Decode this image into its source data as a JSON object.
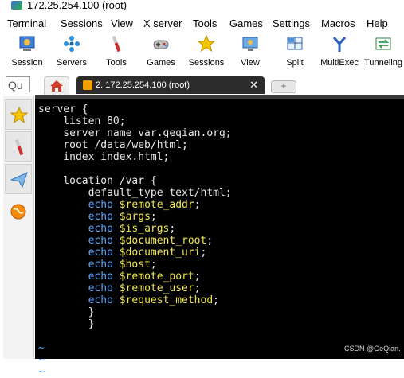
{
  "window": {
    "title": "172.25.254.100 (root)"
  },
  "menu": [
    "Terminal",
    "Sessions",
    "View",
    "X server",
    "Tools",
    "Games",
    "Settings",
    "Macros",
    "Help"
  ],
  "toolbar": [
    {
      "label": "Session",
      "icon": "session-icon"
    },
    {
      "label": "Servers",
      "icon": "servers-icon"
    },
    {
      "label": "Tools",
      "icon": "tools-icon"
    },
    {
      "label": "Games",
      "icon": "games-icon"
    },
    {
      "label": "Sessions",
      "icon": "star-icon"
    },
    {
      "label": "View",
      "icon": "view-icon"
    },
    {
      "label": "Split",
      "icon": "split-icon"
    },
    {
      "label": "MultiExec",
      "icon": "multiexec-icon"
    },
    {
      "label": "Tunneling",
      "icon": "tunneling-icon"
    }
  ],
  "quick_connect": {
    "value": "Qu"
  },
  "tab": {
    "label": "2. 172.25.254.100 (root)",
    "close": "✕"
  },
  "new_tab": "+",
  "terminal": {
    "lines": [
      {
        "text": "server {",
        "type": "plain"
      },
      {
        "text": "    listen 80;",
        "type": "plain"
      },
      {
        "text": "    server_name var.geqian.org;",
        "type": "plain"
      },
      {
        "text": "    root /data/web/html;",
        "type": "plain"
      },
      {
        "text": "    index index.html;",
        "type": "plain"
      },
      {
        "text": "",
        "type": "plain"
      },
      {
        "text": "    location /var {",
        "type": "plain"
      },
      {
        "text": "        default_type text/html;",
        "type": "plain"
      },
      {
        "indent": "        ",
        "kw": "echo",
        "var": "$remote_addr",
        "end": ";",
        "type": "echo"
      },
      {
        "indent": "        ",
        "kw": "echo",
        "var": "$args",
        "end": ";",
        "type": "echo"
      },
      {
        "indent": "        ",
        "kw": "echo",
        "var": "$is_args",
        "end": ";",
        "type": "echo"
      },
      {
        "indent": "        ",
        "kw": "echo",
        "var": "$document_root",
        "end": ";",
        "type": "echo"
      },
      {
        "indent": "        ",
        "kw": "echo",
        "var": "$document_uri",
        "end": ";",
        "type": "echo"
      },
      {
        "indent": "        ",
        "kw": "echo",
        "var": "$host",
        "end": ";",
        "type": "echo"
      },
      {
        "indent": "        ",
        "kw": "echo",
        "var": "$remote_port",
        "end": ";",
        "type": "echo"
      },
      {
        "indent": "        ",
        "kw": "echo",
        "var": "$remote_user",
        "end": ";",
        "type": "echo"
      },
      {
        "indent": "        ",
        "kw": "echo",
        "var": "$request_method",
        "end": ";",
        "type": "echo"
      },
      {
        "text": "        }",
        "type": "plain"
      },
      {
        "text": "        }",
        "type": "plain"
      },
      {
        "text": "",
        "type": "plain"
      },
      {
        "text": "~",
        "type": "tilde"
      },
      {
        "text": "~",
        "type": "tilde"
      },
      {
        "text": "~",
        "type": "tilde"
      }
    ]
  },
  "watermark": "CSDN @GeQian.",
  "colors": {
    "terminal_bg": "#000000",
    "keyword": "#5aa7ff",
    "variable": "#f2e94e",
    "tab_active": "#2b2b2b"
  }
}
